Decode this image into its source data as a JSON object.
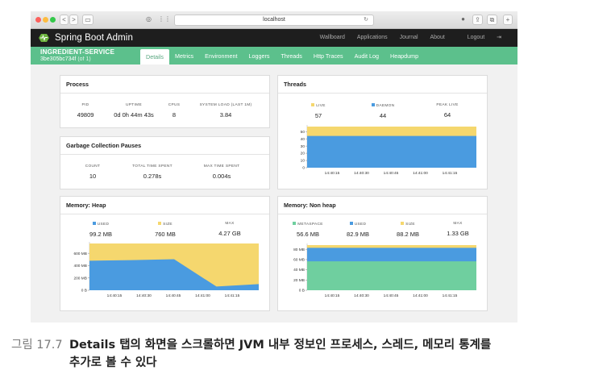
{
  "browser": {
    "url": "localhost",
    "back": "<",
    "forward": ">"
  },
  "app": {
    "brand": "Spring Boot Admin",
    "nav": [
      "Wallboard",
      "Applications",
      "Journal",
      "About"
    ],
    "logout": "Logout",
    "app_name": "INGREDIENT-SERVICE",
    "app_id": "3be305bc734f",
    "app_id_suffix": "(of 1)",
    "tabs": [
      "Details",
      "Metrics",
      "Environment",
      "Loggers",
      "Threads",
      "Http Traces",
      "Audit Log",
      "Heapdump"
    ],
    "active_tab": "Details"
  },
  "process": {
    "title": "Process",
    "stats": [
      {
        "label": "PID",
        "value": "49809"
      },
      {
        "label": "UPTIME",
        "value": "0d 0h 44m 43s"
      },
      {
        "label": "CPUS",
        "value": "8"
      },
      {
        "label": "SYSTEM LOAD (LAST 1M)",
        "value": "3.84"
      }
    ]
  },
  "gc": {
    "title": "Garbage Collection Pauses",
    "stats": [
      {
        "label": "COUNT",
        "value": "10"
      },
      {
        "label": "TOTAL TIME SPENT",
        "value": "0.278s"
      },
      {
        "label": "MAX TIME SPENT",
        "value": "0.004s"
      }
    ]
  },
  "threads": {
    "title": "Threads",
    "stats": [
      {
        "label": "LIVE",
        "value": "57",
        "color": "#f5d76e"
      },
      {
        "label": "DAEMON",
        "value": "44",
        "color": "#4a9be0"
      },
      {
        "label": "PEAK LIVE",
        "value": "64",
        "color": ""
      }
    ],
    "y_ticks": [
      "50",
      "40",
      "30",
      "20",
      "10",
      "0"
    ],
    "x_ticks": [
      "14:40:15",
      "14:40:30",
      "14:40:45",
      "14:41:00",
      "14:41:15"
    ]
  },
  "heap": {
    "title": "Memory: Heap",
    "stats": [
      {
        "label": "USED",
        "value": "99.2 MB",
        "color": "#4a9be0"
      },
      {
        "label": "SIZE",
        "value": "760 MB",
        "color": "#f5d76e"
      },
      {
        "label": "MAX",
        "value": "4.27 GB",
        "color": ""
      }
    ],
    "y_ticks": [
      "600 MB",
      "400 MB",
      "200 MB",
      "0 B"
    ],
    "x_ticks": [
      "14:40:15",
      "14:40:30",
      "14:40:45",
      "14:41:00",
      "14:41:15"
    ]
  },
  "nonheap": {
    "title": "Memory: Non heap",
    "stats": [
      {
        "label": "METASPACE",
        "value": "56.6 MB",
        "color": "#6fcf9f"
      },
      {
        "label": "USED",
        "value": "82.9 MB",
        "color": "#4a9be0"
      },
      {
        "label": "SIZE",
        "value": "88.2 MB",
        "color": "#f5d76e"
      },
      {
        "label": "MAX",
        "value": "1.33 GB",
        "color": ""
      }
    ],
    "y_ticks": [
      "80 MB",
      "60 MB",
      "40 MB",
      "20 MB",
      "0 B"
    ],
    "x_ticks": [
      "14:40:15",
      "14:40:30",
      "14:40:45",
      "14:41:00",
      "14:41:15"
    ]
  },
  "chart_data": [
    {
      "type": "area",
      "title": "Threads",
      "x": [
        "14:40:15",
        "14:40:30",
        "14:40:45",
        "14:41:00",
        "14:41:15"
      ],
      "series": [
        {
          "name": "LIVE",
          "values": [
            57,
            57,
            57,
            57,
            57
          ]
        },
        {
          "name": "DAEMON",
          "values": [
            44,
            44,
            44,
            44,
            44
          ]
        }
      ],
      "ylim": [
        0,
        57
      ]
    },
    {
      "type": "area",
      "title": "Memory: Heap",
      "x": [
        "14:40:15",
        "14:40:30",
        "14:40:45",
        "14:41:00",
        "14:41:15"
      ],
      "series": [
        {
          "name": "SIZE",
          "values": [
            760,
            760,
            760,
            760,
            760
          ]
        },
        {
          "name": "USED",
          "values": [
            480,
            490,
            505,
            60,
            99.2
          ]
        }
      ],
      "y_unit": "MB",
      "ylim": [
        0,
        760
      ]
    },
    {
      "type": "area",
      "title": "Memory: Non heap",
      "x": [
        "14:40:15",
        "14:40:30",
        "14:40:45",
        "14:41:00",
        "14:41:15"
      ],
      "series": [
        {
          "name": "SIZE",
          "values": [
            88.2,
            88.2,
            88.2,
            88.2,
            88.2
          ]
        },
        {
          "name": "USED",
          "values": [
            82.9,
            82.9,
            82.9,
            82.9,
            82.9
          ]
        },
        {
          "name": "METASPACE",
          "values": [
            56.6,
            56.6,
            56.6,
            56.6,
            56.6
          ]
        }
      ],
      "y_unit": "MB",
      "ylim": [
        0,
        88.2
      ]
    }
  ],
  "caption": {
    "figure": "그림 17.7",
    "line1": "Details 탭의 화면을 스크롤하면 JVM 내부 정보인 프로세스, 스레드, 메모리 통계를",
    "line2": "추가로 볼 수 있다"
  }
}
